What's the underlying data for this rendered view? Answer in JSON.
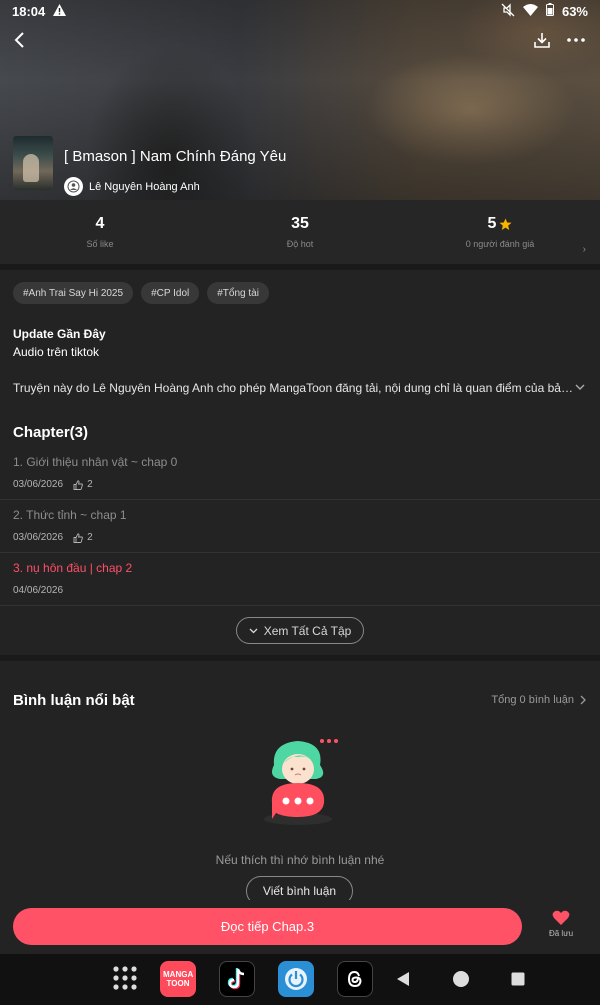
{
  "status": {
    "time": "18:04",
    "battery": "63%"
  },
  "manga": {
    "title": "[ Bmason ] Nam Chính Đáng Yêu",
    "author": "Lê Nguyên Hoàng Anh"
  },
  "stats": [
    {
      "value": "4",
      "label": "Số like"
    },
    {
      "value": "35",
      "label": "Độ hot"
    },
    {
      "value": "5",
      "label": "0 người đánh giá"
    }
  ],
  "tags": [
    "#Anh Trai Say Hi 2025",
    "#CP Idol",
    "#Tổng tài"
  ],
  "update": {
    "title": "Update Gần Đây",
    "text": "Audio trên tiktok"
  },
  "description": "Truyện này do Lê Nguyên Hoàng Anh cho phép MangaToon đăng tải, nội dung chỉ là quan điểm của bản...",
  "chapters_header": "Chapter(3)",
  "chapters": [
    {
      "name": "1. Giới thiệu nhân vật ~ chap 0",
      "date": "03/06/2026",
      "likes": "2"
    },
    {
      "name": "2. Thức tỉnh ~ chap 1",
      "date": "03/06/2026",
      "likes": "2"
    },
    {
      "name": "3. nụ hôn đầu | chap 2",
      "date": "04/06/2026"
    }
  ],
  "see_all": "Xem Tất Cả Tập",
  "comments": {
    "title": "Bình luận nổi bật",
    "total": "Tổng 0 bình luận",
    "hint": "Nếu thích thì nhớ bình luận nhé",
    "button": "Viết bình luận"
  },
  "actions": {
    "read": "Đọc tiếp Chap.3",
    "saved": "Đã lưu"
  },
  "apps": {
    "mangatoon": "MANGA TOON"
  },
  "colors": {
    "accent": "#ff5266",
    "current_chapter": "#ff4f66",
    "star": "#f7b500"
  }
}
